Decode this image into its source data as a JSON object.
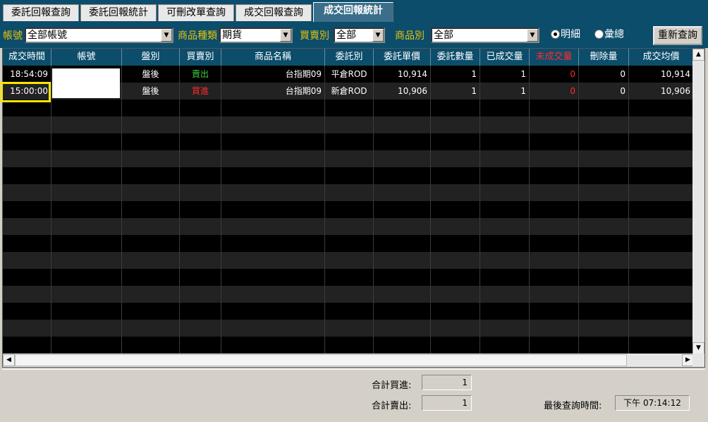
{
  "tabs": [
    {
      "label": "委託回報查詢"
    },
    {
      "label": "委託回報統計"
    },
    {
      "label": "可刪改單查詢"
    },
    {
      "label": "成交回報查詢"
    },
    {
      "label": "成交回報統計"
    }
  ],
  "filters": {
    "account_label": "帳號",
    "account_value": "全部帳號",
    "product_type_label": "商品種類",
    "product_type_value": "期貨",
    "side_label": "買賣別",
    "side_value": "全部",
    "product_label": "商品別",
    "product_value": "全部",
    "radio_detail": "明細",
    "radio_summary": "彙總",
    "requery_button": "重新查詢"
  },
  "table": {
    "headers": [
      "成交時間",
      "帳號",
      "盤別",
      "買賣別",
      "商品名稱",
      "委託別",
      "委託單價",
      "委託數量",
      "已成交量",
      "未成交量",
      "刪除量",
      "成交均價"
    ],
    "rows": [
      {
        "time": "18:54:09",
        "account": "",
        "session": "盤後",
        "side": "賣出",
        "product": "台指期09",
        "order_type": "平倉ROD",
        "price": "10,914",
        "qty": "1",
        "filled": "1",
        "unfilled": "0",
        "deleted": "0",
        "avg_price": "10,914"
      },
      {
        "time": "15:00:00",
        "account": "",
        "session": "盤後",
        "side": "買進",
        "product": "台指期09",
        "order_type": "新倉ROD",
        "price": "10,906",
        "qty": "1",
        "filled": "1",
        "unfilled": "0",
        "deleted": "0",
        "avg_price": "10,906"
      }
    ]
  },
  "footer": {
    "total_buy_label": "合計買進:",
    "total_buy_value": "1",
    "total_sell_label": "合計賣出:",
    "total_sell_value": "1",
    "last_query_label": "最後查詢時間:",
    "last_query_value": "下午  07:14:12"
  },
  "colors": {
    "sell": "#3fcf3f",
    "buy": "#ff2a2a",
    "unfilled": "#ff2a2a",
    "header_bg": "#0b4d6b",
    "label_gold": "#e7c20a",
    "highlight": "#ffe600"
  },
  "icons": {
    "dropdown": "chevron-down-icon",
    "scroll_up": "scroll-up-arrow-icon",
    "scroll_down": "scroll-down-arrow-icon",
    "scroll_left": "scroll-left-arrow-icon",
    "scroll_right": "scroll-right-arrow-icon"
  }
}
